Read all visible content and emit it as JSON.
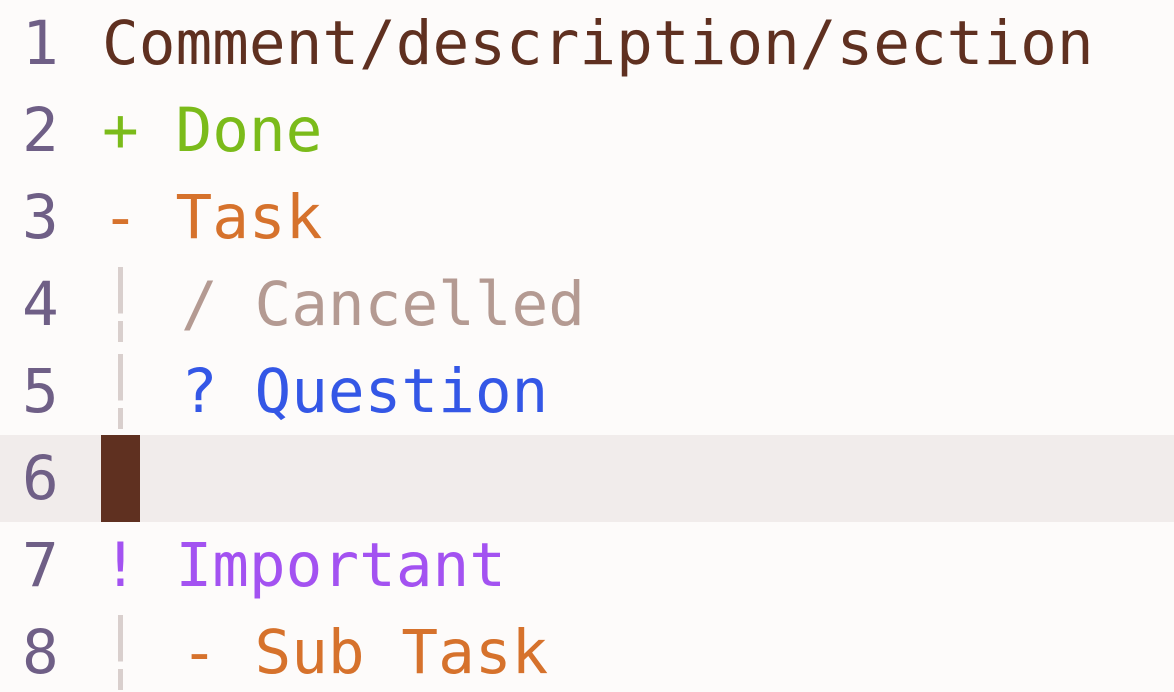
{
  "colors": {
    "background": "#fdfbfa",
    "current_line": "#f1eceb",
    "line_number": "#6f5f86",
    "comment": "#5f3020",
    "done": "#7bbb1a",
    "task": "#d6722c",
    "cancelled": "#b49a92",
    "question": "#3457e6",
    "important": "#a352f1",
    "indent_guide": "#d9cfcd",
    "cursor": "#5f3020"
  },
  "lines": [
    {
      "number": "1",
      "text": "Comment/description/section"
    },
    {
      "number": "2",
      "marker": "+",
      "text": "Done"
    },
    {
      "number": "3",
      "marker": "-",
      "text": "Task"
    },
    {
      "number": "4",
      "marker": "/",
      "text": "Cancelled"
    },
    {
      "number": "5",
      "marker": "?",
      "text": "Question"
    },
    {
      "number": "6"
    },
    {
      "number": "7",
      "marker": "!",
      "text": "Important"
    },
    {
      "number": "8",
      "marker": "-",
      "text": "Sub Task"
    }
  ]
}
